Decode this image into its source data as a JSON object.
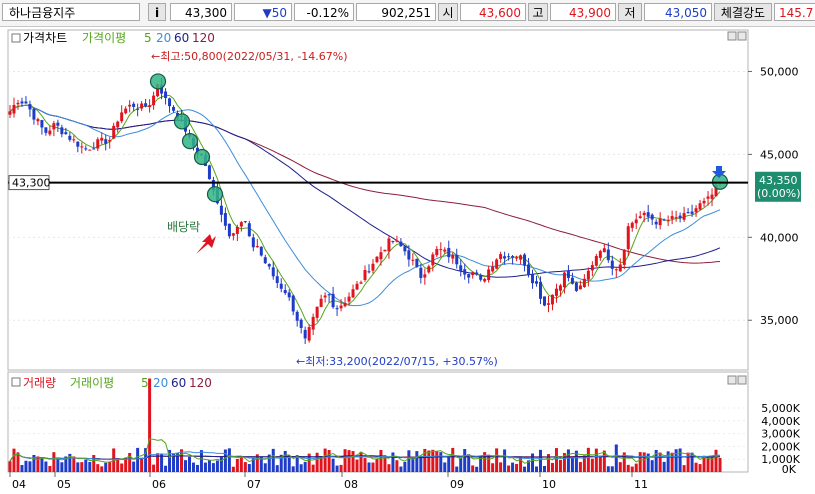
{
  "toolbar": {
    "stock_name": "하나금융지주",
    "info_button": "i",
    "price": "43,300",
    "change": "▼50",
    "change_pct": "-0.12%",
    "volume": "902,251",
    "open_label": "시",
    "open_value": "43,600",
    "high_label": "고",
    "high_value": "43,900",
    "low_label": "저",
    "low_value": "43,050",
    "strength_label": "체결강도",
    "strength_value": "145.7"
  },
  "price_panel": {
    "legend": {
      "title": "가격차트",
      "ma_label": "가격이평",
      "ma_periods": [
        "5",
        "20",
        "60",
        "120"
      ]
    },
    "high_annotation": "←최고:50,800(2022/05/31, -14.67%)",
    "low_annotation": "←최저:33,200(2022/07/15, +30.57%)",
    "dividend_label": "배당락",
    "left_price_tag": "43,300",
    "right_price_tag": "43,350",
    "right_pct_tag": "(0.00%)"
  },
  "volume_panel": {
    "legend": {
      "title": "거래량",
      "ma_label": "거래이평",
      "ma_periods": [
        "5",
        "20",
        "60",
        "120"
      ]
    }
  },
  "x_axis_labels": [
    "04",
    "05",
    "06",
    "07",
    "08",
    "09",
    "10",
    "11"
  ],
  "colors": {
    "up": "#e0141e",
    "down": "#1e3cc8",
    "ma5": "#57a51e",
    "ma20": "#3c8cdc",
    "ma60": "#1e1e8c",
    "ma120": "#8c1e3c",
    "signal": "#32b482"
  },
  "chart_data": [
    {
      "type": "candlestick",
      "title": "가격차트",
      "ylim": [
        32000,
        52500
      ],
      "y_ticks": [
        35000,
        40000,
        45000,
        50000
      ],
      "y_tick_labels": [
        "35,000",
        "40,000",
        "45,000",
        "50,000"
      ],
      "series_names": [
        "가격이평 5",
        "20",
        "60",
        "120"
      ],
      "close_path": [
        [
          0,
          47600
        ],
        [
          8,
          48300
        ],
        [
          16,
          48100
        ],
        [
          25,
          47200
        ],
        [
          35,
          46300
        ],
        [
          45,
          46800
        ],
        [
          60,
          46000
        ],
        [
          75,
          45300
        ],
        [
          88,
          45700
        ],
        [
          100,
          45900
        ],
        [
          110,
          47500
        ],
        [
          122,
          48000
        ],
        [
          133,
          47800
        ],
        [
          142,
          48200
        ],
        [
          148,
          49400
        ],
        [
          155,
          48300
        ],
        [
          165,
          47600
        ],
        [
          173,
          46900
        ],
        [
          180,
          45800
        ],
        [
          187,
          45200
        ],
        [
          194,
          44700
        ],
        [
          201,
          43000
        ],
        [
          206,
          42500
        ],
        [
          213,
          41200
        ],
        [
          218,
          40200
        ],
        [
          224,
          40500
        ],
        [
          230,
          40800
        ],
        [
          236,
          40900
        ],
        [
          241,
          39300
        ],
        [
          246,
          39700
        ],
        [
          252,
          38800
        ],
        [
          260,
          38000
        ],
        [
          268,
          37200
        ],
        [
          275,
          36800
        ],
        [
          282,
          35900
        ],
        [
          289,
          34800
        ],
        [
          295,
          33700
        ],
        [
          302,
          34800
        ],
        [
          310,
          36100
        ],
        [
          318,
          36600
        ],
        [
          326,
          35700
        ],
        [
          334,
          36100
        ],
        [
          342,
          36700
        ],
        [
          350,
          37300
        ],
        [
          358,
          38100
        ],
        [
          366,
          38700
        ],
        [
          374,
          39400
        ],
        [
          381,
          39800
        ],
        [
          388,
          39600
        ],
        [
          396,
          39100
        ],
        [
          404,
          38400
        ],
        [
          410,
          37600
        ],
        [
          416,
          38100
        ],
        [
          422,
          38800
        ],
        [
          428,
          39300
        ],
        [
          434,
          39100
        ],
        [
          440,
          38900
        ],
        [
          446,
          38600
        ],
        [
          452,
          38100
        ],
        [
          458,
          37800
        ],
        [
          464,
          37900
        ],
        [
          470,
          37200
        ],
        [
          477,
          37900
        ],
        [
          484,
          38600
        ],
        [
          490,
          39000
        ],
        [
          498,
          38900
        ],
        [
          506,
          38900
        ],
        [
          513,
          38700
        ],
        [
          520,
          37700
        ],
        [
          527,
          37100
        ],
        [
          534,
          35900
        ],
        [
          541,
          36400
        ],
        [
          548,
          37100
        ],
        [
          556,
          37900
        ],
        [
          562,
          37100
        ],
        [
          569,
          36700
        ],
        [
          576,
          37600
        ],
        [
          582,
          38400
        ],
        [
          590,
          39400
        ],
        [
          597,
          39000
        ],
        [
          604,
          38100
        ],
        [
          611,
          38500
        ],
        [
          618,
          40600
        ],
        [
          625,
          41100
        ],
        [
          632,
          41300
        ],
        [
          640,
          41200
        ],
        [
          648,
          40900
        ],
        [
          656,
          41000
        ],
        [
          664,
          41100
        ],
        [
          672,
          41200
        ],
        [
          680,
          41300
        ],
        [
          688,
          41900
        ],
        [
          696,
          42100
        ],
        [
          704,
          42700
        ],
        [
          710,
          43350
        ]
      ],
      "volume_max": 7500,
      "y2_ticks": [
        1000,
        2000,
        3000,
        4000,
        5000
      ],
      "y2_tick_labels": [
        "1,000K",
        "2,000K",
        "3,000K",
        "4,000K",
        "5,000K"
      ],
      "y2_zero_label": "0K"
    }
  ]
}
